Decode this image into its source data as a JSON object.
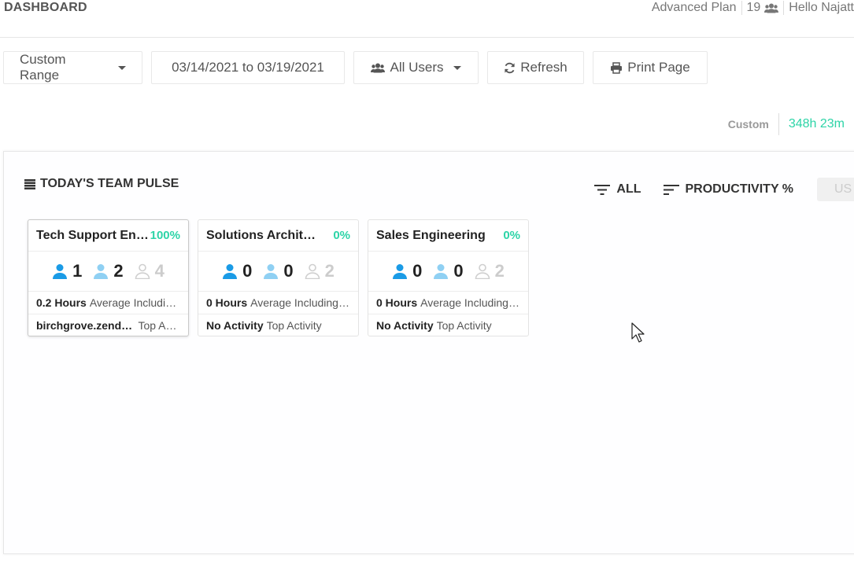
{
  "header": {
    "title": "DASHBOARD",
    "plan": "Advanced Plan",
    "user_count": "19",
    "greeting": "Hello Najatt"
  },
  "filters": {
    "range_label": "Custom Range",
    "date_range": "03/14/2021 to 03/19/2021",
    "users_label": "All Users",
    "refresh_label": "Refresh",
    "print_label": "Print Page"
  },
  "summary": {
    "label": "Custom",
    "value": "348h 23m",
    "value_color": "#2dd4a7"
  },
  "pulse": {
    "title": "TODAY'S TEAM PULSE",
    "filter_label": "ALL",
    "sort_label": "PRODUCTIVITY %",
    "us_label": "US",
    "cards": [
      {
        "name": "Tech Support Engineering",
        "pct": "100%",
        "active": "1",
        "idle": "2",
        "offline": "4",
        "hours": "0.2 Hours",
        "hours_desc": "Average Including Idle Time",
        "activity": "birchgrove.zendesk.com",
        "activity_desc": "Top Activity"
      },
      {
        "name": "Solutions Architecture",
        "pct": "0%",
        "active": "0",
        "idle": "0",
        "offline": "2",
        "hours": "0 Hours",
        "hours_desc": "Average Including Idle Time",
        "activity": "No Activity",
        "activity_desc": "Top Activity"
      },
      {
        "name": "Sales Engineering",
        "pct": "0%",
        "active": "0",
        "idle": "0",
        "offline": "2",
        "hours": "0 Hours",
        "hours_desc": "Average Including Idle Time",
        "activity": "No Activity",
        "activity_desc": "Top Activity"
      }
    ]
  },
  "colors": {
    "accent": "#2dd4a7",
    "active_user": "#1a9be6",
    "idle_user": "#8fd0f3",
    "offline_user": "#cfcfcf"
  }
}
